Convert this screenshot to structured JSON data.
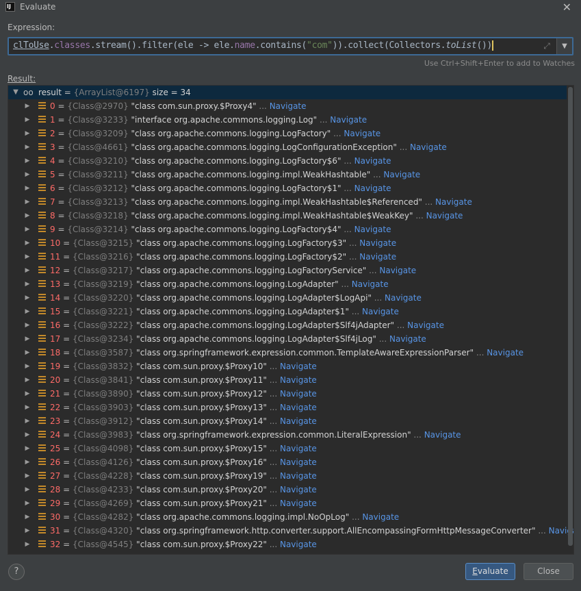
{
  "window": {
    "app_icon_text": "IJ",
    "title": "Evaluate",
    "close_glyph": "✕"
  },
  "expression": {
    "label": "Expression:",
    "value": "clToUse.classes.stream().filter(ele -> ele.name.contains(\"com\")).collect(Collectors.toList())",
    "hint": "Use Ctrl+Shift+Enter to add to Watches",
    "expand_icon": "expand-icon",
    "dropdown_glyph": "▼"
  },
  "result": {
    "label": "Result:",
    "root": {
      "name": "result",
      "ref": "{ArrayList@6197}",
      "size": "size = 34"
    },
    "navigate_label": "Navigate",
    "items": [
      {
        "index": "0",
        "ref": "{Class@2970}",
        "value": "\"class com.sun.proxy.$Proxy4\""
      },
      {
        "index": "1",
        "ref": "{Class@3233}",
        "value": "\"interface org.apache.commons.logging.Log\""
      },
      {
        "index": "2",
        "ref": "{Class@3209}",
        "value": "\"class org.apache.commons.logging.LogFactory\""
      },
      {
        "index": "3",
        "ref": "{Class@4661}",
        "value": "\"class org.apache.commons.logging.LogConfigurationException\""
      },
      {
        "index": "4",
        "ref": "{Class@3210}",
        "value": "\"class org.apache.commons.logging.LogFactory$6\""
      },
      {
        "index": "5",
        "ref": "{Class@3211}",
        "value": "\"class org.apache.commons.logging.impl.WeakHashtable\""
      },
      {
        "index": "6",
        "ref": "{Class@3212}",
        "value": "\"class org.apache.commons.logging.LogFactory$1\""
      },
      {
        "index": "7",
        "ref": "{Class@3213}",
        "value": "\"class org.apache.commons.logging.impl.WeakHashtable$Referenced\""
      },
      {
        "index": "8",
        "ref": "{Class@3218}",
        "value": "\"class org.apache.commons.logging.impl.WeakHashtable$WeakKey\""
      },
      {
        "index": "9",
        "ref": "{Class@3214}",
        "value": "\"class org.apache.commons.logging.LogFactory$4\""
      },
      {
        "index": "10",
        "ref": "{Class@3215}",
        "value": "\"class org.apache.commons.logging.LogFactory$3\""
      },
      {
        "index": "11",
        "ref": "{Class@3216}",
        "value": "\"class org.apache.commons.logging.LogFactory$2\""
      },
      {
        "index": "12",
        "ref": "{Class@3217}",
        "value": "\"class org.apache.commons.logging.LogFactoryService\""
      },
      {
        "index": "13",
        "ref": "{Class@3219}",
        "value": "\"class org.apache.commons.logging.LogAdapter\""
      },
      {
        "index": "14",
        "ref": "{Class@3220}",
        "value": "\"class org.apache.commons.logging.LogAdapter$LogApi\""
      },
      {
        "index": "15",
        "ref": "{Class@3221}",
        "value": "\"class org.apache.commons.logging.LogAdapter$1\""
      },
      {
        "index": "16",
        "ref": "{Class@3222}",
        "value": "\"class org.apache.commons.logging.LogAdapter$Slf4jAdapter\""
      },
      {
        "index": "17",
        "ref": "{Class@3234}",
        "value": "\"class org.apache.commons.logging.LogAdapter$Slf4jLog\""
      },
      {
        "index": "18",
        "ref": "{Class@3587}",
        "value": "\"class org.springframework.expression.common.TemplateAwareExpressionParser\""
      },
      {
        "index": "19",
        "ref": "{Class@3832}",
        "value": "\"class com.sun.proxy.$Proxy10\""
      },
      {
        "index": "20",
        "ref": "{Class@3841}",
        "value": "\"class com.sun.proxy.$Proxy11\""
      },
      {
        "index": "21",
        "ref": "{Class@3890}",
        "value": "\"class com.sun.proxy.$Proxy12\""
      },
      {
        "index": "22",
        "ref": "{Class@3903}",
        "value": "\"class com.sun.proxy.$Proxy13\""
      },
      {
        "index": "23",
        "ref": "{Class@3912}",
        "value": "\"class com.sun.proxy.$Proxy14\""
      },
      {
        "index": "24",
        "ref": "{Class@3983}",
        "value": "\"class org.springframework.expression.common.LiteralExpression\""
      },
      {
        "index": "25",
        "ref": "{Class@4098}",
        "value": "\"class com.sun.proxy.$Proxy15\""
      },
      {
        "index": "26",
        "ref": "{Class@4126}",
        "value": "\"class com.sun.proxy.$Proxy16\""
      },
      {
        "index": "27",
        "ref": "{Class@4228}",
        "value": "\"class com.sun.proxy.$Proxy19\""
      },
      {
        "index": "28",
        "ref": "{Class@4233}",
        "value": "\"class com.sun.proxy.$Proxy20\""
      },
      {
        "index": "29",
        "ref": "{Class@4269}",
        "value": "\"class com.sun.proxy.$Proxy21\""
      },
      {
        "index": "30",
        "ref": "{Class@4282}",
        "value": "\"class org.apache.commons.logging.impl.NoOpLog\""
      },
      {
        "index": "31",
        "ref": "{Class@4320}",
        "value": "\"class org.springframework.http.converter.support.AllEncompassingFormHttpMessageConverter\""
      },
      {
        "index": "32",
        "ref": "{Class@4545}",
        "value": "\"class com.sun.proxy.$Proxy22\""
      }
    ]
  },
  "footer": {
    "help_label": "?",
    "evaluate_label": "Evaluate",
    "close_label": "Close"
  }
}
